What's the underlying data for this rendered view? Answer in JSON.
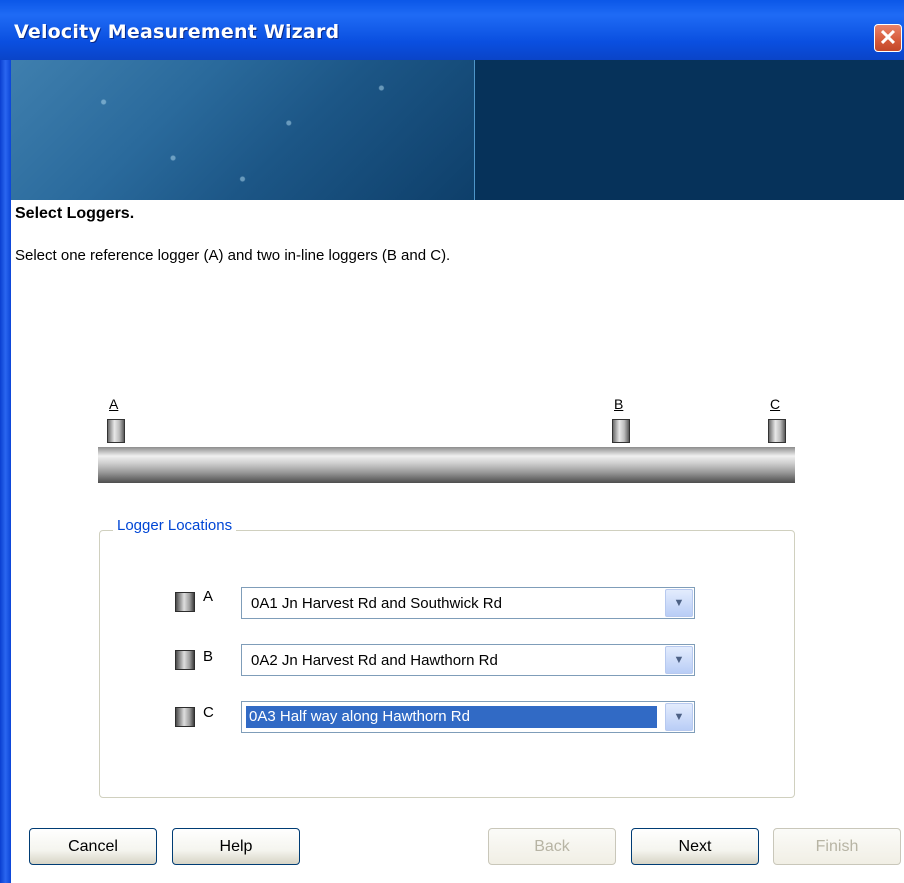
{
  "window": {
    "title": "Velocity Measurement Wizard",
    "close_glyph": "✕"
  },
  "page": {
    "heading": "Select Loggers.",
    "instruction": "Select one reference logger (A) and two in-line loggers (B and C)."
  },
  "diagram": {
    "labels": {
      "a": "A",
      "b": "B",
      "c": "C"
    }
  },
  "logger_locations": {
    "legend": "Logger Locations",
    "rows": [
      {
        "label": "A",
        "value": "0A1 Jn Harvest Rd and Southwick Rd",
        "selected": false
      },
      {
        "label": "B",
        "value": "0A2 Jn Harvest Rd and Hawthorn Rd",
        "selected": false
      },
      {
        "label": "C",
        "value": "0A3 Half way along Hawthorn Rd",
        "selected": true
      }
    ],
    "arrow_glyph": "▼"
  },
  "buttons": {
    "cancel": "Cancel",
    "help": "Help",
    "back": "Back",
    "next": "Next",
    "finish": "Finish"
  }
}
